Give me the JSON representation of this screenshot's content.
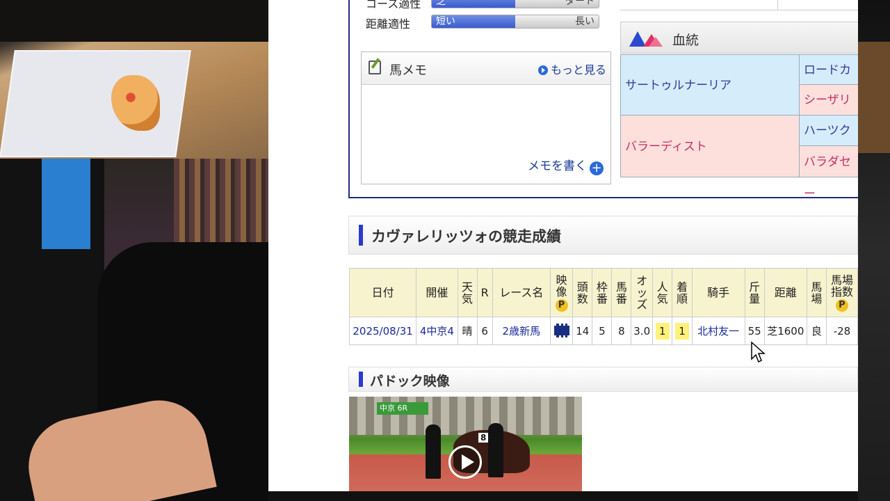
{
  "aptitude": {
    "course": {
      "label": "コース適性",
      "left": "芝",
      "right": "ダート"
    },
    "distance": {
      "label": "距離適性",
      "left": "短い",
      "right": "長い"
    }
  },
  "memo": {
    "title": "馬メモ",
    "more_label": "もっと見る",
    "write_label": "メモを書く"
  },
  "pedigree": {
    "title": "血統",
    "sire": "サートゥルナーリア",
    "sire_sire": "ロードカナ",
    "sire_dam": "シーザリオ",
    "dam": "バラーディスト",
    "dam_sire": "ハーツクラ",
    "dam_dam": "バラダセー"
  },
  "results": {
    "heading": "カヴァレリッツォの競走成績",
    "columns": [
      {
        "key": "date",
        "label": "日付"
      },
      {
        "key": "venue",
        "label": "開催"
      },
      {
        "key": "weather",
        "label": "天気"
      },
      {
        "key": "race_no",
        "label": "R"
      },
      {
        "key": "race_name",
        "label": "レース名"
      },
      {
        "key": "video",
        "label": "映像"
      },
      {
        "key": "heads",
        "label": "頭数"
      },
      {
        "key": "frame",
        "label": "枠番"
      },
      {
        "key": "horse_no",
        "label": "馬番"
      },
      {
        "key": "odds",
        "label": "オッズ"
      },
      {
        "key": "popularity",
        "label": "人気"
      },
      {
        "key": "finish",
        "label": "着順"
      },
      {
        "key": "jockey",
        "label": "騎手"
      },
      {
        "key": "weight",
        "label": "斤量"
      },
      {
        "key": "distance",
        "label": "距離"
      },
      {
        "key": "track",
        "label": "馬場"
      },
      {
        "key": "track_index",
        "label": "馬場指数"
      }
    ],
    "badge": "P",
    "rows": [
      {
        "date": "2025/08/31",
        "venue": "4中京4",
        "weather": "晴",
        "race_no": "6",
        "race_name": "2歳新馬",
        "heads": "14",
        "frame": "5",
        "horse_no": "8",
        "odds": "3.0",
        "popularity": "1",
        "finish": "1",
        "jockey": "北村友一",
        "weight": "55",
        "distance": "芝1600",
        "track": "良",
        "track_index": "-28"
      }
    ]
  },
  "paddock": {
    "heading": "パドック映像",
    "sign_text": "中京 6R",
    "bib": "8"
  },
  "colors": {
    "accent": "#2a3ad0",
    "link": "#1a2a9a",
    "header_bg": "#f7f3cf",
    "highlight": "#fff27a",
    "sire_bg": "#d5ecfb",
    "dam_bg": "#fde0dc"
  }
}
